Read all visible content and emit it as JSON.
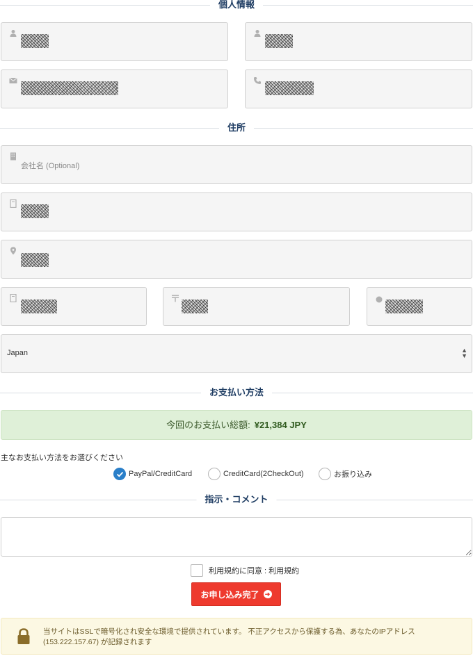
{
  "sections": {
    "personal": "個人情報",
    "address": "住所",
    "payment": "お支払い方法",
    "comment": "指示・コメント"
  },
  "fields": {
    "company_placeholder": "会社名 (Optional)",
    "country_value": "Japan"
  },
  "payment": {
    "total_label": "今回のお支払い総額:",
    "total_amount": "¥21,384 JPY",
    "choose_text": "主なお支払い方法をお選びください",
    "methods": [
      "PayPal/CreditCard",
      "CreditCard(2CheckOut)",
      "お振り込み"
    ],
    "selected": "PayPal/CreditCard"
  },
  "terms_label": "利用規約に同意 : 利用規約",
  "submit_label": "お申し込み完了",
  "ssl_notice": "当サイトはSSLで暗号化され安全な環境で提供されています。 不正アクセスから保護する為、あなたのIPアドレス (153.222.157.67) が記録されます",
  "colors": {
    "accent_blue": "#2a7fc9",
    "submit_red": "#ee3a2e",
    "heading_navy": "#1f3d63",
    "success_bg": "#dff0d8",
    "warning_bg": "#fcf8e3"
  },
  "icons": [
    "user-icon",
    "envelope-icon",
    "phone-icon",
    "building-icon",
    "map-marker-icon",
    "postal-icon",
    "circle-icon",
    "lock-icon",
    "check-icon",
    "arrow-circle-right-icon"
  ]
}
